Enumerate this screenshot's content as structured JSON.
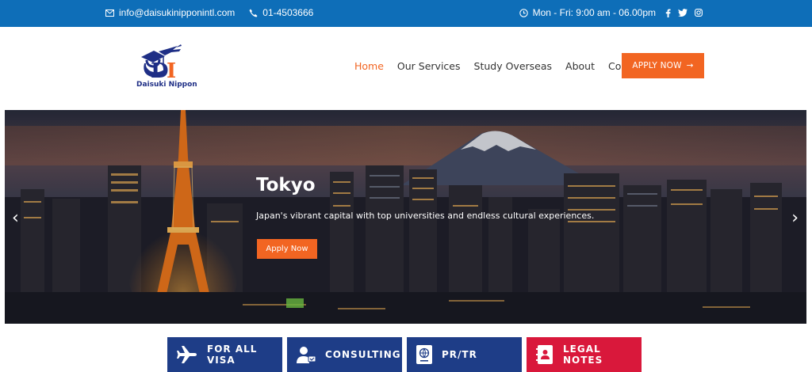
{
  "topbar": {
    "email": "info@daisukinipponintl.com",
    "phone": "01-4503666",
    "hours": "Mon - Fri: 9:00 am - 06.00pm",
    "social_icons": [
      "facebook-icon",
      "twitter-icon",
      "instagram-icon"
    ]
  },
  "header": {
    "logo_text": "Daisuki Nippon",
    "nav": [
      "Home",
      "Our Services",
      "Study Overseas",
      "About",
      "Contact Us"
    ],
    "apply_label": "APPLY NOW",
    "apply_arrow": "→"
  },
  "hero": {
    "title": "Tokyo",
    "description": "Japan's vibrant capital with top universities and endless cultural experiences.",
    "button_label": "Apply Now",
    "prev_arrow": "‹",
    "next_arrow": "›"
  },
  "cards": [
    {
      "label": "FOR ALL VISA",
      "icon": "airplane-icon"
    },
    {
      "label": "CONSULTING",
      "icon": "consulting-icon"
    },
    {
      "label": "PR/TR",
      "icon": "passport-icon"
    },
    {
      "label": "LEGAL NOTES",
      "icon": "contact-book-icon"
    }
  ],
  "colors": {
    "topbar": "#0e6eb8",
    "accent": "#f26522",
    "card_blue": "#1e3d87",
    "card_red": "#d9183b"
  }
}
